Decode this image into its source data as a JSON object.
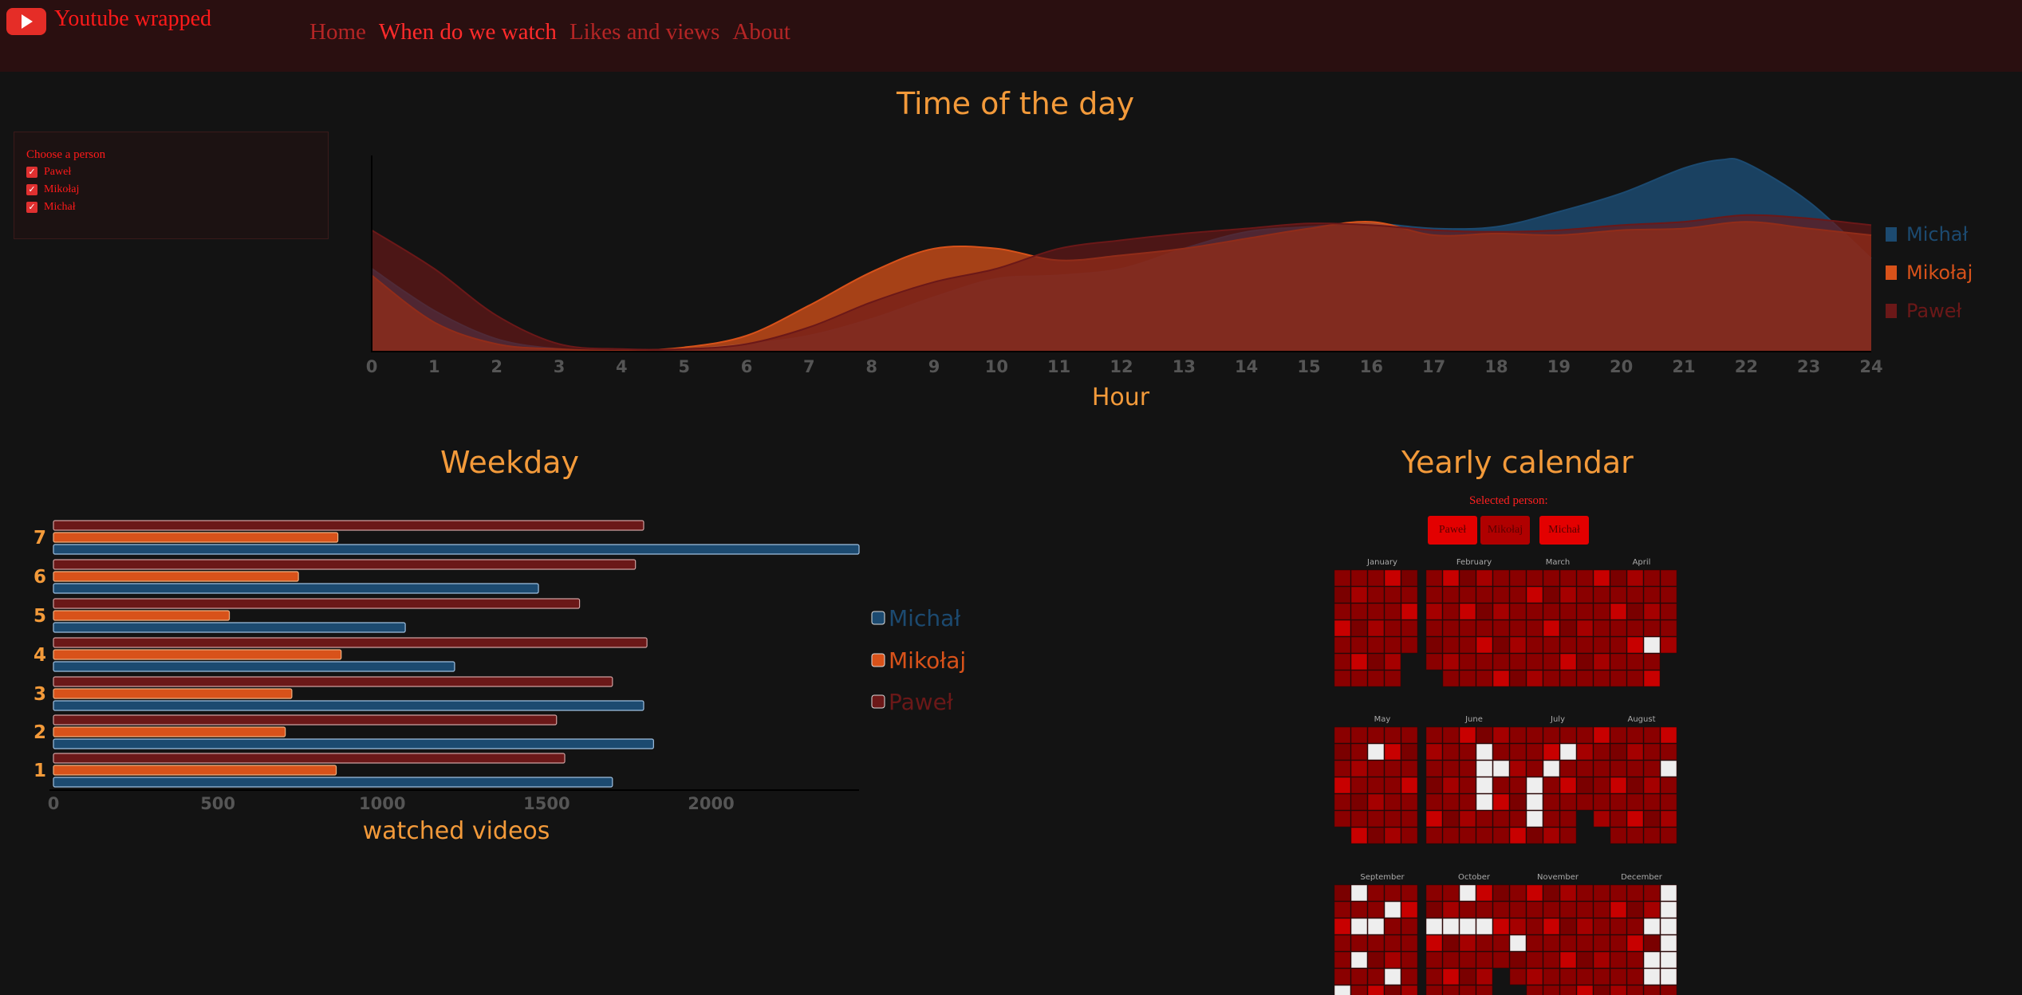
{
  "app": {
    "title": "Youtube wrapped"
  },
  "nav": {
    "items": [
      {
        "label": "Home",
        "active": false
      },
      {
        "label": "When do we watch",
        "active": true
      },
      {
        "label": "Likes and views",
        "active": false
      },
      {
        "label": "About",
        "active": false
      }
    ]
  },
  "person_filter": {
    "title": "Choose a person",
    "options": [
      {
        "label": "Paweł",
        "checked": true
      },
      {
        "label": "Mikołaj",
        "checked": true
      },
      {
        "label": "Michał",
        "checked": true
      }
    ]
  },
  "calendar": {
    "title": "Yearly calendar",
    "selected_label": "Selected person:",
    "buttons": [
      "Paweł",
      "Mikołaj",
      "Michał"
    ],
    "months": [
      "January",
      "February",
      "March",
      "April",
      "May",
      "June",
      "July",
      "August",
      "September",
      "October",
      "November",
      "December"
    ]
  },
  "colors": {
    "michal": "#1c4a70",
    "mikolaj": "#d8521a",
    "pawel": "#6b1818",
    "accent": "#f39a3a"
  },
  "chart_data": [
    {
      "type": "area",
      "title": "Time of the day",
      "xlabel": "Hour",
      "xlim": [
        0,
        24
      ],
      "x_ticks": [
        0,
        1,
        2,
        3,
        4,
        5,
        6,
        7,
        8,
        9,
        10,
        11,
        12,
        13,
        14,
        15,
        16,
        17,
        18,
        19,
        20,
        21,
        22,
        23,
        24
      ],
      "legend": "right",
      "series": [
        {
          "name": "Michał",
          "x": [
            0,
            1,
            2,
            3,
            4,
            5,
            6,
            7,
            8,
            9,
            10,
            11,
            12,
            13,
            14,
            15,
            16,
            17,
            18,
            19,
            20,
            21,
            21.6,
            22,
            23,
            24
          ],
          "values": [
            0.5,
            0.25,
            0.08,
            0.02,
            0.01,
            0.02,
            0.05,
            0.1,
            0.2,
            0.33,
            0.44,
            0.46,
            0.5,
            0.62,
            0.72,
            0.75,
            0.77,
            0.74,
            0.75,
            0.84,
            0.95,
            1.1,
            1.15,
            1.13,
            0.9,
            0.56
          ]
        },
        {
          "name": "Mikołaj",
          "x": [
            0,
            1,
            2,
            3,
            4,
            5,
            6,
            7,
            8,
            9,
            10,
            11,
            12,
            13,
            14,
            15,
            16,
            17,
            18,
            19,
            20,
            21,
            22,
            23,
            24
          ],
          "values": [
            0.46,
            0.18,
            0.05,
            0.02,
            0.01,
            0.03,
            0.1,
            0.28,
            0.48,
            0.62,
            0.62,
            0.55,
            0.58,
            0.62,
            0.68,
            0.74,
            0.78,
            0.7,
            0.71,
            0.7,
            0.73,
            0.74,
            0.78,
            0.74,
            0.7
          ]
        },
        {
          "name": "Paweł",
          "x": [
            0,
            1,
            2,
            3,
            4,
            5,
            6,
            7,
            8,
            9,
            10,
            11,
            12,
            13,
            14,
            15,
            16,
            17,
            18,
            19,
            20,
            21,
            22,
            23,
            24
          ],
          "values": [
            0.73,
            0.5,
            0.22,
            0.05,
            0.02,
            0.02,
            0.05,
            0.15,
            0.3,
            0.42,
            0.5,
            0.62,
            0.67,
            0.71,
            0.74,
            0.77,
            0.76,
            0.73,
            0.72,
            0.73,
            0.76,
            0.78,
            0.82,
            0.8,
            0.76
          ]
        }
      ]
    },
    {
      "type": "bar",
      "orientation": "horizontal",
      "title": "Weekday",
      "xlabel": "watched videos",
      "xlim": [
        0,
        2450
      ],
      "x_ticks": [
        0,
        500,
        1000,
        1500,
        2000
      ],
      "categories": [
        "1",
        "2",
        "3",
        "4",
        "5",
        "6",
        "7"
      ],
      "legend": "right",
      "series": [
        {
          "name": "Paweł",
          "values": [
            1555,
            1530,
            1700,
            1805,
            1600,
            1770,
            1795
          ]
        },
        {
          "name": "Mikołaj",
          "values": [
            860,
            705,
            725,
            875,
            535,
            745,
            865
          ]
        },
        {
          "name": "Michał",
          "values": [
            1700,
            1825,
            1795,
            1220,
            1070,
            1475,
            2450
          ]
        }
      ]
    }
  ]
}
